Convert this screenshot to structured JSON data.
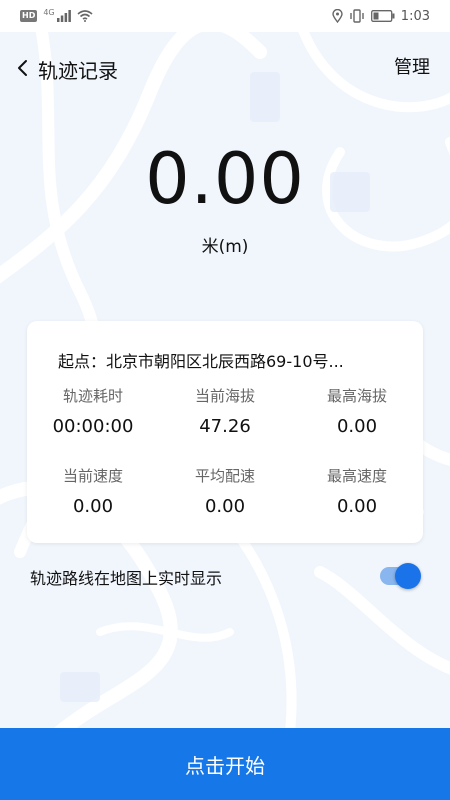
{
  "status_bar": {
    "hd": "HD",
    "network": "4G",
    "time": "1:03",
    "icons": [
      "hd-badge-icon",
      "signal-icon",
      "wifi-icon",
      "location-icon",
      "vibrate-icon",
      "battery-icon"
    ]
  },
  "header": {
    "title": "轨迹记录",
    "manage": "管理"
  },
  "distance": {
    "value": "0.00",
    "unit": "米(m)"
  },
  "card": {
    "start_point": "起点：北京市朝阳区北辰西路69-10号...",
    "stats": [
      {
        "label": "轨迹耗时",
        "value": "00:00:00"
      },
      {
        "label": "当前海拔",
        "value": "47.26"
      },
      {
        "label": "最高海拔",
        "value": "0.00"
      },
      {
        "label": "当前速度",
        "value": "0.00"
      },
      {
        "label": "平均配速",
        "value": "0.00"
      },
      {
        "label": "最高速度",
        "value": "0.00"
      }
    ]
  },
  "toggle": {
    "label": "轨迹路线在地图上实时显示",
    "on": true
  },
  "start_button": "点击开始",
  "colors": {
    "accent": "#1677e8",
    "toggle_track": "#89b6ee",
    "background": "#f4f8fd"
  }
}
